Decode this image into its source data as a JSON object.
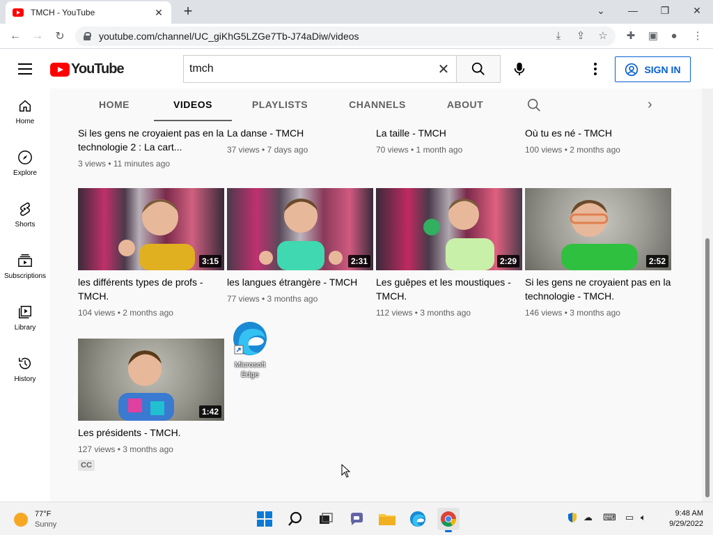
{
  "browser": {
    "tab_title": "TMCH - YouTube",
    "url": "youtube.com/channel/UC_giKhG5LZGe7Tb-J74aDiw/videos"
  },
  "masthead": {
    "logo_text": "YouTube",
    "search_value": "tmch",
    "sign_in_label": "SIGN IN"
  },
  "sidebar": {
    "items": [
      {
        "label": "Home",
        "icon": "home-icon"
      },
      {
        "label": "Explore",
        "icon": "compass-icon"
      },
      {
        "label": "Shorts",
        "icon": "shorts-icon"
      },
      {
        "label": "Subscriptions",
        "icon": "subscriptions-icon"
      },
      {
        "label": "Library",
        "icon": "library-icon"
      },
      {
        "label": "History",
        "icon": "history-icon"
      }
    ]
  },
  "channel_tabs": [
    "HOME",
    "VIDEOS",
    "PLAYLISTS",
    "CHANNELS",
    "ABOUT"
  ],
  "videos_top": [
    {
      "title": "Si les gens ne croyaient pas en la technologie 2 : La cart...",
      "meta": "3 views • 11 minutes ago"
    },
    {
      "title": "La danse - TMCH",
      "meta": "37 views • 7 days ago"
    },
    {
      "title": "La taille - TMCH",
      "meta": "70 views • 1 month ago"
    },
    {
      "title": "Où tu es né - TMCH",
      "meta": "100 views • 2 months ago"
    }
  ],
  "videos_mid": [
    {
      "title": "les différents types de profs - TMCH.",
      "meta": "104 views • 2 months ago",
      "duration": "3:15"
    },
    {
      "title": "les langues étrangère - TMCH",
      "meta": "77 views • 3 months ago",
      "duration": "2:31"
    },
    {
      "title": "Les guêpes et les moustiques - TMCH.",
      "meta": "112 views • 3 months ago",
      "duration": "2:29"
    },
    {
      "title": "Si les gens ne croyaient pas en la technologie - TMCH.",
      "meta": "146 views • 3 months ago",
      "duration": "2:52"
    }
  ],
  "videos_bottom": [
    {
      "title": "Les présidents - TMCH.",
      "meta": "127 views • 3 months ago",
      "duration": "1:42",
      "badge": "CC"
    }
  ],
  "desktop": {
    "edge_label": "Microsoft Edge"
  },
  "taskbar": {
    "temperature": "77°F",
    "condition": "Sunny",
    "time": "9:48 AM",
    "date": "9/29/2022"
  }
}
